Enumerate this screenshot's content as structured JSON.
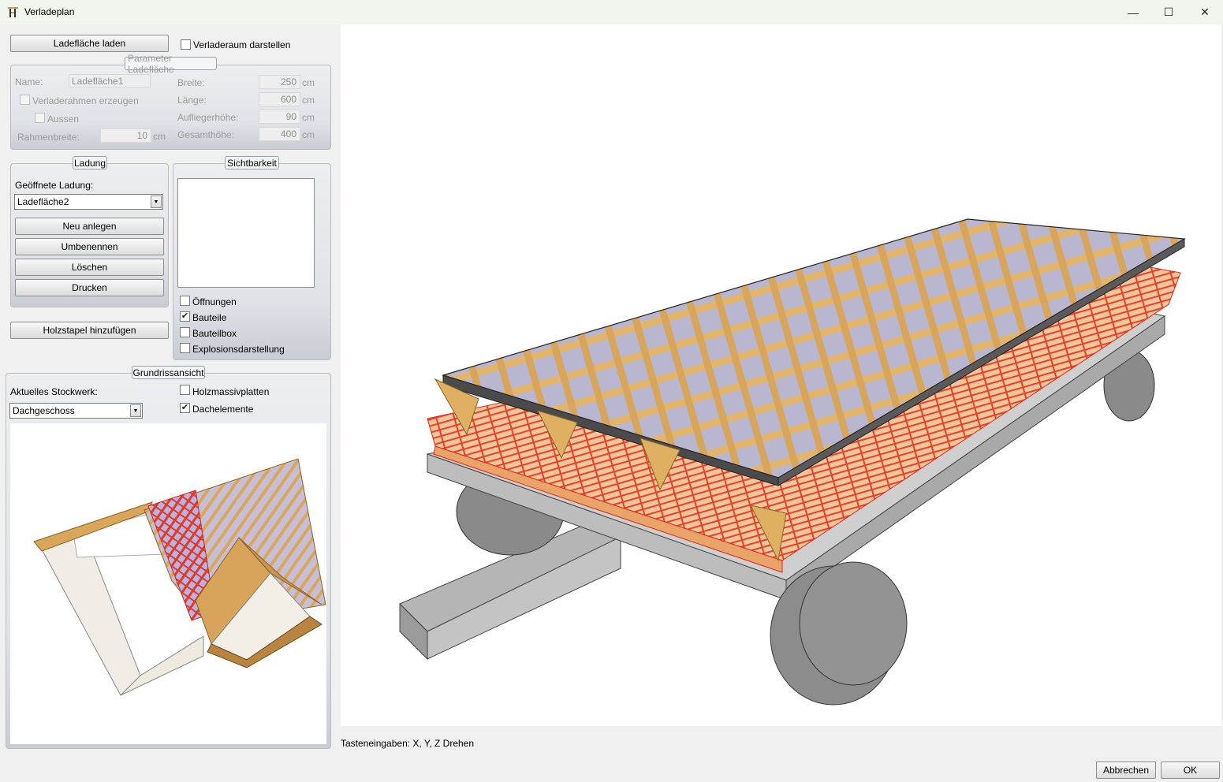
{
  "window": {
    "title": "Verladeplan",
    "minimize_glyph": "—",
    "maximize_glyph": "☐",
    "close_glyph": "✕"
  },
  "top": {
    "load_button": "Ladefläche laden",
    "show_loading_space": "Verladeraum darstellen"
  },
  "params": {
    "legend": "Parameter Ladefläche",
    "name_label": "Name:",
    "name_value": "Ladefläche1",
    "create_frame": "Verladerahmen erzeugen",
    "outside": "Aussen",
    "frame_width_label": "Rahmenbreite:",
    "frame_width_value": "10",
    "width_label": "Breite:",
    "width_value": "250",
    "length_label": "Länge:",
    "length_value": "600",
    "trailer_height_label": "Aufliegerhöhe:",
    "trailer_height_value": "90",
    "total_height_label": "Gesamthöhe:",
    "total_height_value": "400",
    "unit": "cm"
  },
  "load": {
    "legend": "Ladung",
    "opened_label": "Geöffnete Ladung:",
    "opened_value": "Ladefläche2",
    "new_button": "Neu anlegen",
    "rename_button": "Umbenennen",
    "delete_button": "Löschen",
    "print_button": "Drucken"
  },
  "visibility": {
    "legend": "Sichtbarkeit",
    "openings": "Öffnungen",
    "openings_checked": false,
    "parts": "Bauteile",
    "parts_checked": true,
    "partbox": "Bauteilbox",
    "partbox_checked": false,
    "explosion": "Explosionsdarstellung",
    "explosion_checked": false
  },
  "woodstack_button": "Holzstapel hinzufügen",
  "floorplan": {
    "legend": "Grundrissansicht",
    "storey_label": "Aktuelles Stockwerk:",
    "storey_value": "Dachgeschoss",
    "solid_wood_panels": "Holzmassivplatten",
    "solid_wood_checked": false,
    "roof_elements": "Dachelemente",
    "roof_elements_checked": true
  },
  "status_text": "Tasteneingaben: X, Y, Z Drehen",
  "footer": {
    "cancel_button": "Abbrechen",
    "ok_button": "OK"
  },
  "colors": {
    "wood": "#e2b46a",
    "wood_dark": "#b88440",
    "highlight_red": "#e8230f",
    "trailer_grey": "#c4c4c4",
    "wheel_grey": "#8a8a8a",
    "glass": "#a7a9c8"
  }
}
